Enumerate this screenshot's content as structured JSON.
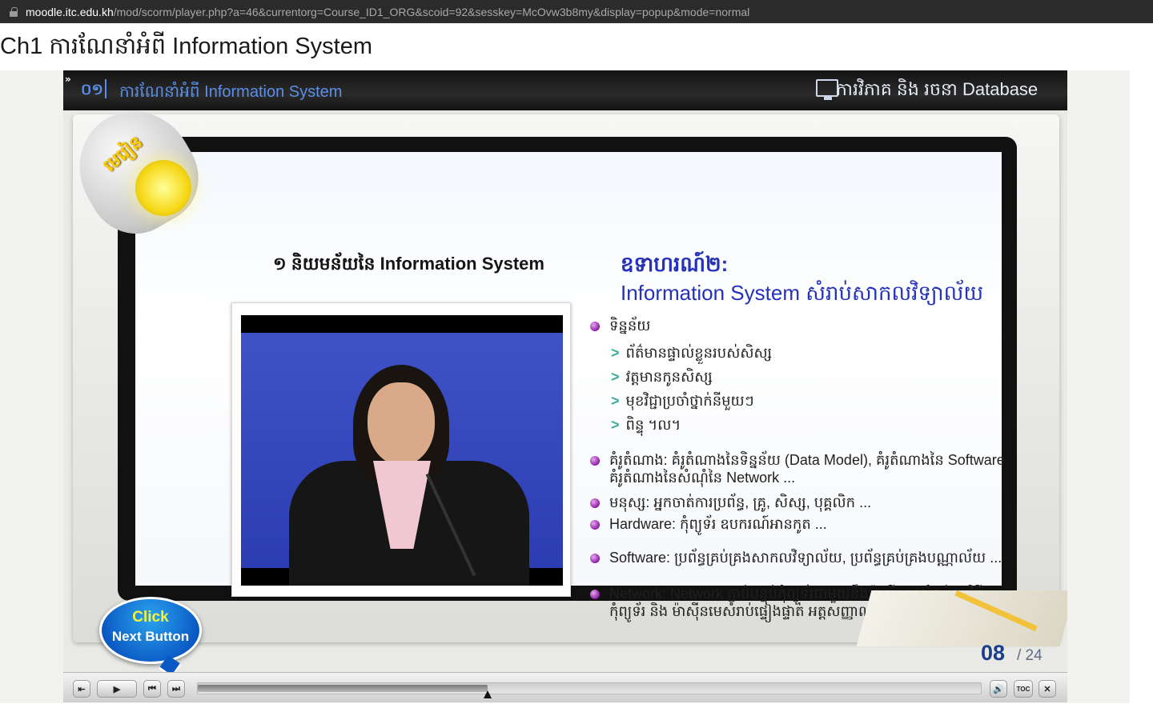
{
  "url": {
    "host": "moodle.itc.edu.kh",
    "path": "/mod/scorm/player.php?a=46&currentorg=Course_ID1_ORG&scoid=92&sesskey=McOvw3b8my&display=popup&mode=normal"
  },
  "page_title": "Ch1 ការណែនាំអំពី Information System",
  "slide": {
    "expand_icon": "»",
    "chapter_number": "០១",
    "chapter_title": "ការណែនាំអំពី Information System",
    "course_title": "ការវិភាគ និង រចនា Database",
    "lesson_badge": "មេរៀន",
    "section_title": "១ និយមន័យនៃ Information System",
    "example_title": "ឧទាហរណ៍២:",
    "example_subtitle": "Information System សំរាប់សាកលវិទ្យាល័យ",
    "bullets": [
      "ទិន្នន័យ",
      "គំរូតំណាង: គំរូតំណាងនៃទិន្នន័យ (Data Model), គំរូតំណាងនៃ Software",
      "គំរូតំណាងនៃសំណុំនៃ Network ...",
      "មនុស្ស: អ្នកចាត់ការប្រព័ន្ធ, គ្រូ, សិស្ស, បុគ្គលិក ...",
      "Hardware: កុំព្យូទ័រ ឧបករណ៍អានកូត ...",
      "Software: ប្រព័ន្ធគ្រប់គ្រងសាកលវិទ្យាល័យ, ប្រព័ន្ធគ្រប់គ្រងបណ្ណាល័យ ...",
      "Network: Network ភ្ជាប់បន្ទប់កុំព្យូទ័រជាមួយនឹងម៉ាស៊ីនមេសំរាប់កម្មវិធី",
      "កុំព្យូទ័រ និង ម៉ាស៊ីនមេសំរាប់ផ្ទៀងផ្ទាត់ អត្តសញ្ញាណ ..."
    ],
    "sub_bullets": [
      "ព័ត៌មានផ្ទាល់ខ្លួនរបស់សិស្ស",
      "វត្តមានកូនសិស្ស",
      "មុខវិជ្ជាប្រចាំថ្នាក់នីមួយៗ",
      "ពិន្ទុ ។ល។"
    ],
    "sub_bullet_marker": ">",
    "click_next_line1": "Click",
    "click_next_line2": "Next Button",
    "page_current": "08",
    "page_total": "/ 24"
  },
  "controls": {
    "exit_icon": "exit-icon",
    "play_icon": "play-icon",
    "prev_icon": "previous-icon",
    "next_icon": "next-icon",
    "volume_icon": "volume-icon",
    "toc_label": "TOC",
    "close_icon": "close-icon",
    "progress_fraction": 0.37
  },
  "colors": {
    "accent_blue": "#2431b8",
    "bullet_purple": "#8b1fa1",
    "arrow_teal": "#3dab9a",
    "chapter_blue": "#5b8ee6"
  }
}
